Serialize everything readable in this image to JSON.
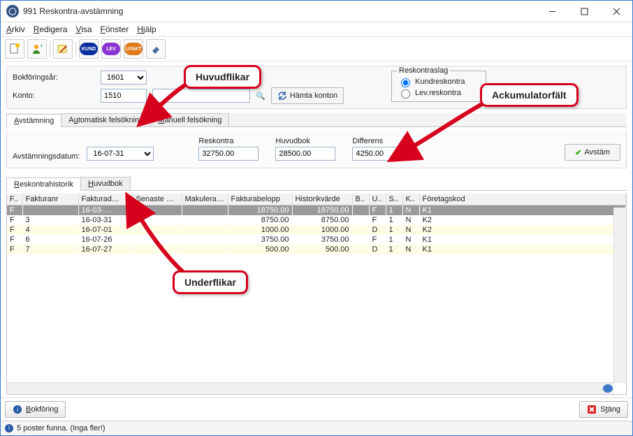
{
  "window": {
    "title": "991 Reskontra-avstämning"
  },
  "menu": {
    "arkiv": "Arkiv",
    "redigera": "Redigera",
    "visa": "Visa",
    "fonster": "Fönster",
    "hjalp": "Hjälp"
  },
  "toolbar_pills": {
    "kund": "KUND",
    "lev": "LEV",
    "lfakt": "LFAKT"
  },
  "form": {
    "bokforingsar_label": "Bokföringsår:",
    "bokforingsar": "1601",
    "konto_label": "Konto:",
    "konto": "1510",
    "konto2": "",
    "hamta_konton": "Hämta konton",
    "reskontraslag_legend": "Reskontraslag",
    "kundreskontra": "Kundreskontra",
    "levreskontra": "Lev.reskontra"
  },
  "main_tabs": {
    "avstamning": "Avstämning",
    "auto": "Automatisk felsökning",
    "manuell": "Manuell felsökning"
  },
  "acc": {
    "reskontra_label": "Reskontra",
    "reskontra": "32750.00",
    "huvudbok_label": "Huvudbok",
    "huvudbok": "28500.00",
    "differens_label": "Differens",
    "differens": "4250.00",
    "avstamdat_label": "Avstämningsdatum:",
    "avstamdat": "16-07-31",
    "avstam_btn": "Avstäm"
  },
  "sub_tabs": {
    "resk": "Reskontrahistorik",
    "huvud": "Huvudbok"
  },
  "grid": {
    "headers": {
      "f": "F..",
      "fakturanr": "Fakturanr",
      "fakturad": "Fakturad…",
      "senaste": "Senaste …",
      "makulera": "Makulera…",
      "fakturabelopp": "Fakturabelopp",
      "historikvarde": "Historikvärde",
      "b": "B..",
      "u": "U..",
      "s": "S..",
      "k": "K..",
      "foretagskod": "Företagskod"
    },
    "rows": [
      {
        "f": "F",
        "fnr": "",
        "fdat": "16-03-…",
        "sen": "",
        "mak": "",
        "bel": "18750.00",
        "hist": "18750.00",
        "b": "",
        "u": "F",
        "s": "1",
        "k": "N",
        "fkod": "K1",
        "sel": true
      },
      {
        "f": "F",
        "fnr": "3",
        "fdat": "16-03-31",
        "sen": "",
        "mak": "",
        "bel": "8750.00",
        "hist": "8750.00",
        "b": "",
        "u": "F",
        "s": "1",
        "k": "N",
        "fkod": "K2",
        "alt": false
      },
      {
        "f": "F",
        "fnr": "4",
        "fdat": "16-07-01",
        "sen": "",
        "mak": "",
        "bel": "1000.00",
        "hist": "1000.00",
        "b": "",
        "u": "D",
        "s": "1",
        "k": "N",
        "fkod": "K2",
        "alt": true
      },
      {
        "f": "F",
        "fnr": "6",
        "fdat": "16-07-26",
        "sen": "",
        "mak": "",
        "bel": "3750.00",
        "hist": "3750.00",
        "b": "",
        "u": "F",
        "s": "1",
        "k": "N",
        "fkod": "K1",
        "alt": false
      },
      {
        "f": "F",
        "fnr": "7",
        "fdat": "16-07-27",
        "sen": "",
        "mak": "",
        "bel": "500.00",
        "hist": "500.00",
        "b": "",
        "u": "D",
        "s": "1",
        "k": "N",
        "fkod": "K1",
        "alt": true
      }
    ]
  },
  "buttons": {
    "bokforing": "Bokföring",
    "stang": "Stäng"
  },
  "status": {
    "text": "5 poster funna. (Inga fler!)"
  },
  "callouts": {
    "huvud": "Huvudflikar",
    "ack": "Ackumulatorfält",
    "under": "Underflikar"
  }
}
